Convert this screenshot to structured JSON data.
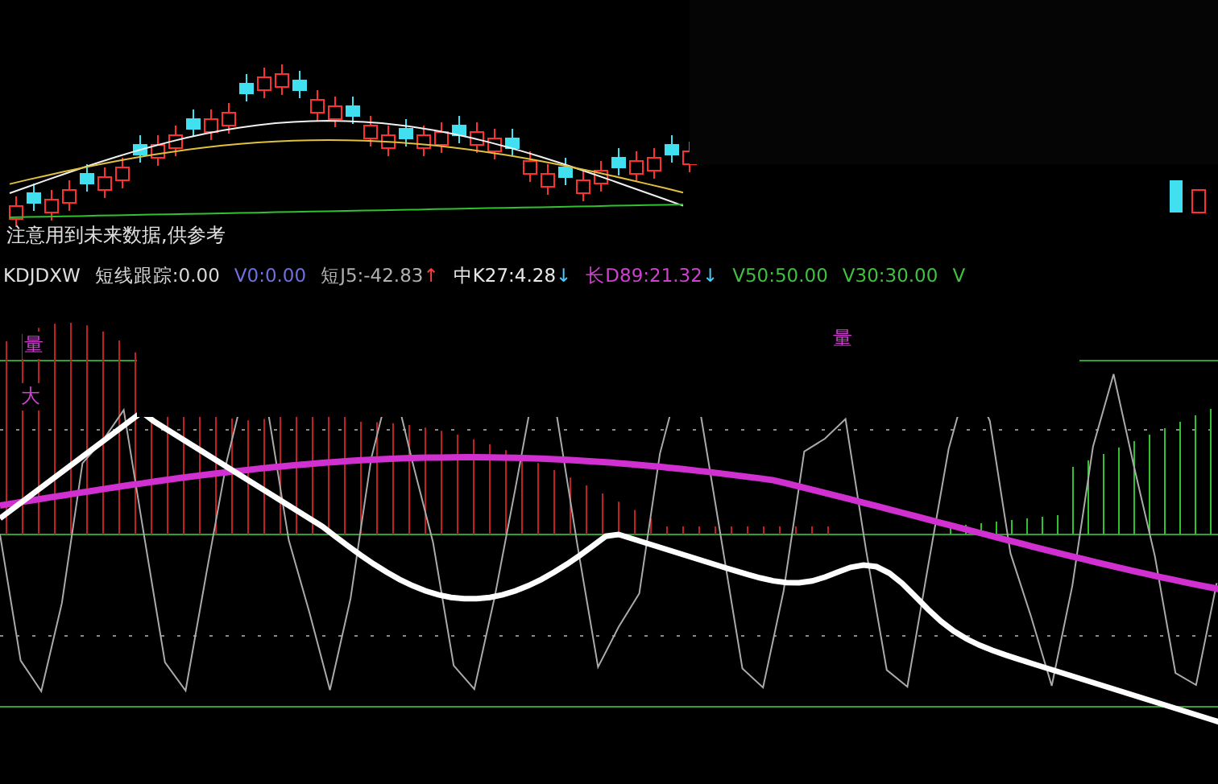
{
  "warning": "注意用到未来数据,供参考",
  "indicator": {
    "name": "KDJDXW",
    "values": [
      {
        "label": "短线跟踪:0.00",
        "color": "#d8d8d8"
      },
      {
        "label": "V0:0.00",
        "color": "#6f6fe0"
      },
      {
        "label": "短J5:-42.83",
        "color": "#b0b0b0",
        "arrow": {
          "symbol": "↑",
          "color": "#ff4040"
        }
      },
      {
        "label": "中K27:4.28",
        "color": "#e8e8e8",
        "arrow": {
          "symbol": "↓",
          "color": "#40d0ff"
        }
      },
      {
        "label": "长D89:21.32",
        "color": "#d040d0",
        "arrow": {
          "symbol": "↓",
          "color": "#40d0ff"
        }
      },
      {
        "label": "V50:50.00",
        "color": "#40c040"
      },
      {
        "label": "V30:30.00",
        "color": "#40c040"
      },
      {
        "label": "V",
        "color": "#40c040"
      }
    ]
  },
  "panel_labels": [
    {
      "text": "量",
      "color": "#d040d0"
    },
    {
      "text": "大",
      "color": "#d040d0"
    },
    {
      "text": "量",
      "color": "#d040d0"
    }
  ]
}
